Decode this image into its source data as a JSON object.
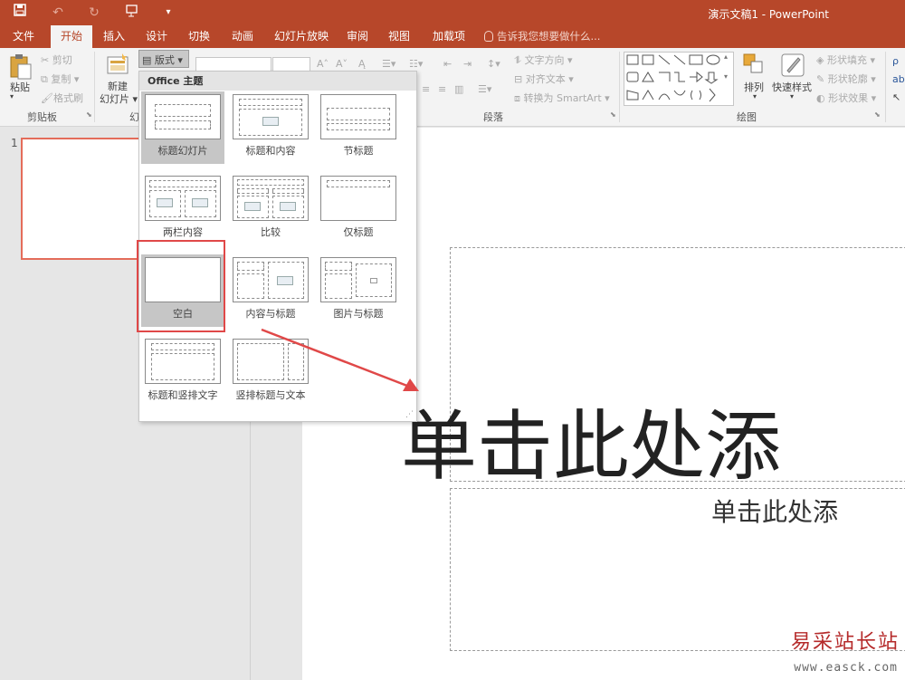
{
  "app": {
    "title": "演示文稿1 - PowerPoint"
  },
  "quick_access": {
    "save_icon": "save-icon",
    "undo_icon": "undo-icon",
    "redo_icon": "redo-icon",
    "present_icon": "present-from-start-icon",
    "customize_icon": "customize-qa-icon"
  },
  "tabs": [
    {
      "label": "文件"
    },
    {
      "label": "开始"
    },
    {
      "label": "插入"
    },
    {
      "label": "设计"
    },
    {
      "label": "切换"
    },
    {
      "label": "动画"
    },
    {
      "label": "幻灯片放映"
    },
    {
      "label": "审阅"
    },
    {
      "label": "视图"
    },
    {
      "label": "加载项"
    }
  ],
  "tellme": "告诉我您想要做什么...",
  "ribbon": {
    "clipboard": {
      "label": "剪贴板",
      "paste": "粘贴",
      "cut": "剪切",
      "copy": "复制",
      "format_painter": "格式刷"
    },
    "slides": {
      "label": "幻",
      "new_slide_line1": "新建",
      "new_slide_line2": "幻灯片",
      "layout": "版式"
    },
    "paragraph": {
      "label": "段落",
      "text_direction": "文字方向",
      "align_text": "对齐文本",
      "smartart": "转换为 SmartArt"
    },
    "drawing": {
      "label": "绘图",
      "arrange": "排列",
      "quick_styles": "快速样式",
      "shape_fill": "形状填充",
      "shape_outline": "形状轮廓",
      "shape_effects": "形状效果"
    }
  },
  "layout_menu": {
    "header": "Office 主题",
    "items": [
      {
        "label": "标题幻灯片"
      },
      {
        "label": "标题和内容"
      },
      {
        "label": "节标题"
      },
      {
        "label": "两栏内容"
      },
      {
        "label": "比较"
      },
      {
        "label": "仅标题"
      },
      {
        "label": "空白"
      },
      {
        "label": "内容与标题"
      },
      {
        "label": "图片与标题"
      },
      {
        "label": "标题和竖排文字"
      },
      {
        "label": "竖排标题与文本"
      }
    ],
    "selected": "标题幻灯片"
  },
  "slide_panel": {
    "number": "1"
  },
  "slide": {
    "title_placeholder": "单击此处添",
    "subtitle_placeholder": "单击此处添"
  },
  "watermark": {
    "text": "易采站长站",
    "url": "www.easck.com"
  },
  "colors": {
    "accent": "#b7472a",
    "highlight": "#e04848"
  }
}
